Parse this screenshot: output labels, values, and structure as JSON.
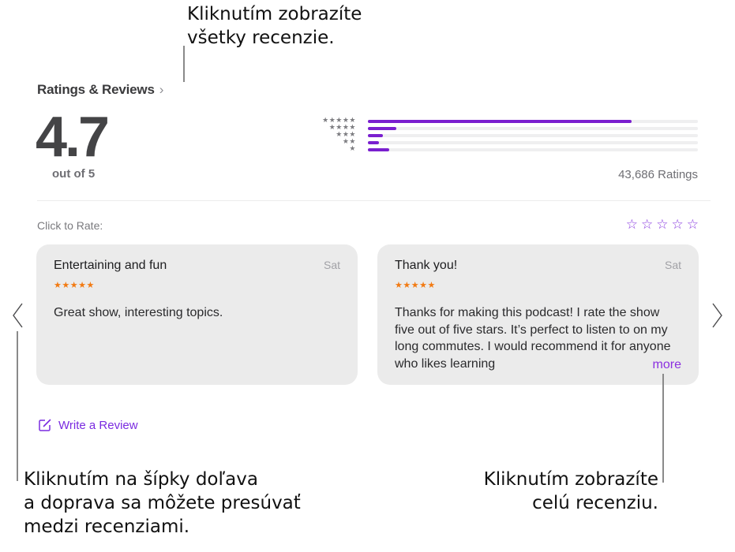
{
  "callouts": {
    "top": [
      "Kliknutím zobrazíte",
      "všetky recenzie."
    ],
    "left": [
      "Kliknutím na šípky doľava",
      "a doprava sa môžete presúvať",
      "medzi recenziami."
    ],
    "right": [
      "Kliknutím zobrazíte",
      "celú recenziu."
    ]
  },
  "header": {
    "title": "Ratings & Reviews",
    "chevron": "›"
  },
  "summary": {
    "average": "4.7",
    "out_of": "out of 5",
    "ratings_count": "43,686 Ratings"
  },
  "histogram": [
    {
      "stars": 5,
      "label": "★★★★★",
      "fraction": 0.8
    },
    {
      "stars": 4,
      "label": "★★★★",
      "fraction": 0.085
    },
    {
      "stars": 3,
      "label": "★★★",
      "fraction": 0.045
    },
    {
      "stars": 2,
      "label": "★★",
      "fraction": 0.033
    },
    {
      "stars": 1,
      "label": "★",
      "fraction": 0.065
    }
  ],
  "rate": {
    "label": "Click to Rate:",
    "stars": [
      "☆",
      "☆",
      "☆",
      "☆",
      "☆"
    ]
  },
  "reviews": [
    {
      "title": "Entertaining and fun",
      "date": "Sat",
      "stars": "★★★★★",
      "body": "Great show, interesting topics."
    },
    {
      "title": "Thank you!",
      "date": "Sat",
      "stars": "★★★★★",
      "body": "Thanks for making this podcast! I rate the show five out of five stars. It’s perfect to listen to on my long commutes. I would recommend it for anyone who likes learning",
      "more": "more"
    }
  ],
  "write_review": {
    "label": "Write a Review",
    "icon": "compose-icon"
  },
  "colors": {
    "accent": "#7a1fcf",
    "star_orange": "#f27a12",
    "card_bg": "#ebebeb"
  }
}
